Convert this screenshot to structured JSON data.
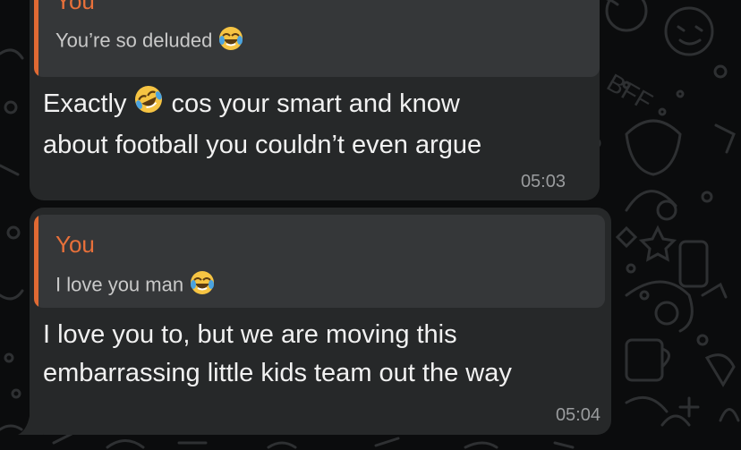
{
  "messages": [
    {
      "reply_sender": "You",
      "reply_text": "You’re so deluded",
      "reply_emoji": "laughing-tears-icon",
      "text_line1_a": "Exactly",
      "text_emoji": "rolling-laughing-icon",
      "text_line1_b": "cos your smart and know",
      "text_line2": "about football you couldn’t even argue",
      "time": "05:03"
    },
    {
      "reply_sender": "You",
      "reply_text": "I love you man",
      "reply_emoji": "laughing-tears-icon",
      "text_line1": "I love you to, but we are moving this",
      "text_line2": "embarrassing little kids team out the way",
      "time": "05:04"
    }
  ],
  "colors": {
    "background": "#0b0c0d",
    "bubble": "#262829",
    "quote_background": "#353739",
    "quote_accent": "#e06a33"
  }
}
